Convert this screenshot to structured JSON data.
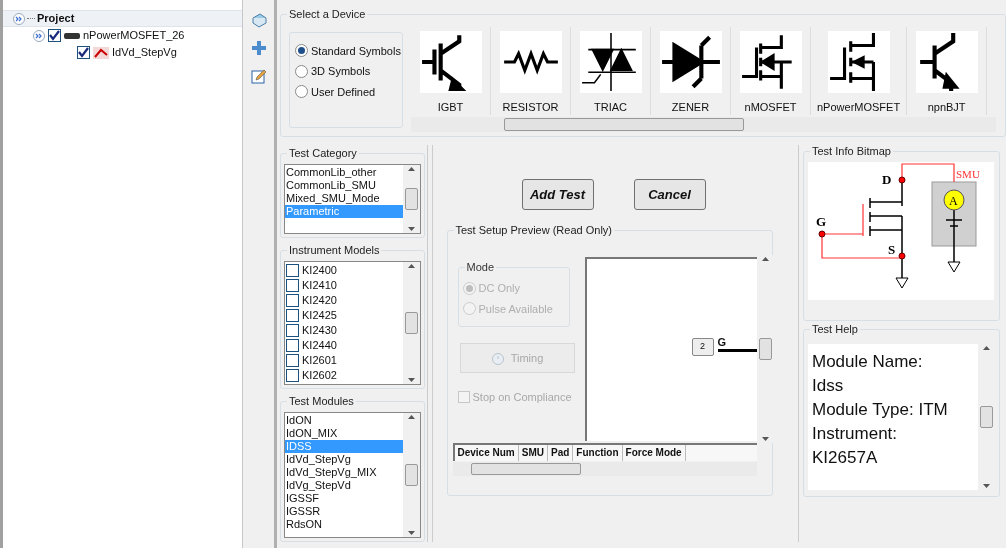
{
  "tree": {
    "label": "Project",
    "children": [
      {
        "label": "nPowerMOSFET_26",
        "checked": true,
        "children": [
          {
            "label": "IdVd_StepVg",
            "checked": true
          }
        ]
      }
    ]
  },
  "device_panel": {
    "title": "Select a Device",
    "symbol_options": [
      {
        "label": "Standard Symbols",
        "selected": true
      },
      {
        "label": "3D Symbols",
        "selected": false
      },
      {
        "label": "User Defined",
        "selected": false
      }
    ],
    "devices": [
      {
        "label": "IGBT",
        "kind": "igbt"
      },
      {
        "label": "RESISTOR",
        "kind": "resistor"
      },
      {
        "label": "TRIAC",
        "kind": "triac"
      },
      {
        "label": "ZENER",
        "kind": "zener"
      },
      {
        "label": "nMOSFET",
        "kind": "mosfet"
      },
      {
        "label": "nPowerMOSFET",
        "kind": "powermosfet"
      },
      {
        "label": "npnBJT",
        "kind": "bjt"
      }
    ]
  },
  "test_category": {
    "title": "Test Category",
    "items": [
      {
        "label": "CommonLib_other",
        "selected": false
      },
      {
        "label": "CommonLib_SMU",
        "selected": false
      },
      {
        "label": "Mixed_SMU_Mode",
        "selected": false
      },
      {
        "label": "Parametric",
        "selected": true
      }
    ]
  },
  "instrument_models": {
    "title": "Instrument Models",
    "items": [
      {
        "label": "KI2400",
        "checked": false
      },
      {
        "label": "KI2410",
        "checked": false
      },
      {
        "label": "KI2420",
        "checked": false
      },
      {
        "label": "KI2425",
        "checked": false
      },
      {
        "label": "KI2430",
        "checked": false
      },
      {
        "label": "KI2440",
        "checked": false
      },
      {
        "label": "KI2601",
        "checked": false
      },
      {
        "label": "KI2602",
        "checked": false
      }
    ]
  },
  "test_modules": {
    "title": "Test Modules",
    "items": [
      {
        "label": "IdON",
        "selected": false
      },
      {
        "label": "IdON_MIX",
        "selected": false
      },
      {
        "label": "IDSS",
        "selected": true
      },
      {
        "label": "IdVd_StepVg",
        "selected": false
      },
      {
        "label": "IdVd_StepVg_MIX",
        "selected": false
      },
      {
        "label": "IdVg_StepVd",
        "selected": false
      },
      {
        "label": "IGSSF",
        "selected": false
      },
      {
        "label": "IGSSR",
        "selected": false
      },
      {
        "label": "RdsON",
        "selected": false
      }
    ]
  },
  "buttons": [
    "Add Test",
    "Cancel"
  ],
  "setup_preview": {
    "title": "Test Setup Preview (Read Only)",
    "mode": {
      "title": "Mode",
      "disabled": true,
      "options": [
        {
          "label": "DC Only",
          "selected": true
        },
        {
          "label": "Pulse Available",
          "selected": false
        }
      ]
    },
    "timing_button": {
      "label": "Timing",
      "disabled": true
    },
    "stop_on_compliance": {
      "label": "Stop on Compliance",
      "checked": false,
      "disabled": true
    },
    "pin": {
      "number": "2",
      "label": "G"
    },
    "table_columns": [
      "Device Num",
      "SMU",
      "Pad",
      "Function",
      "Force Mode"
    ]
  },
  "test_info": {
    "title": "Test Info Bitmap",
    "drain": "D",
    "gate": "G",
    "source": "S",
    "smu": "SMU",
    "meter": "A"
  },
  "test_help": {
    "title": "Test Help",
    "lines": [
      "Module Name:",
      "Idss",
      "Module Type: ITM",
      "Instrument:",
      "KI2657A"
    ]
  }
}
